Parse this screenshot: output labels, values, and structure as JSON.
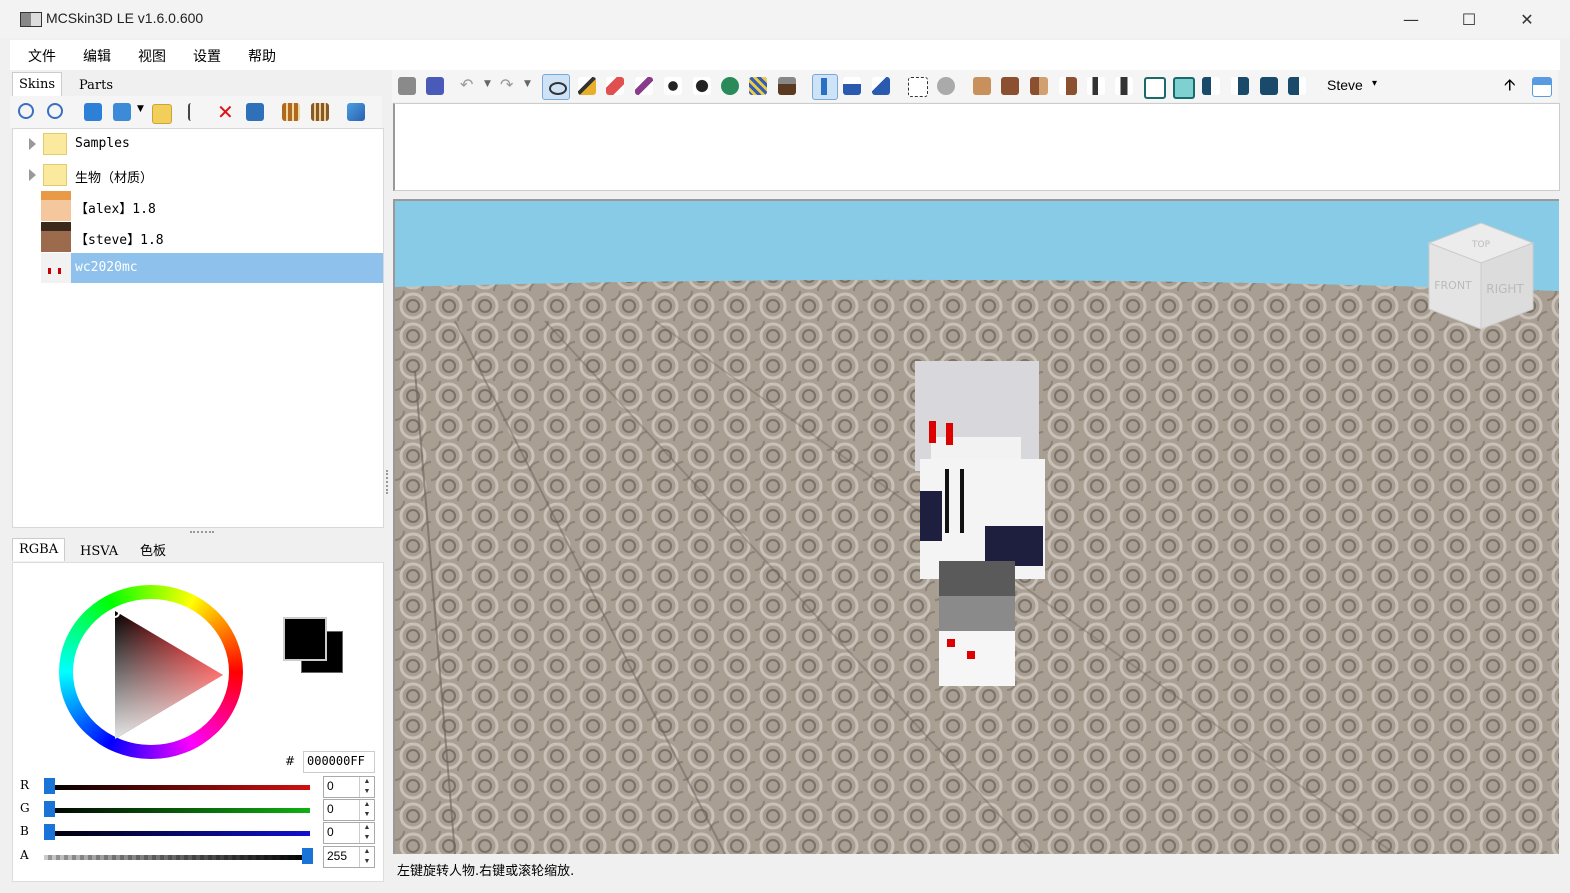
{
  "window": {
    "title": "MCSkin3D LE v1.6.0.600",
    "minimize_glyph": "—",
    "maximize_glyph": "☐",
    "close_glyph": "✕"
  },
  "menu": [
    "文件",
    "编辑",
    "视图",
    "设置",
    "帮助"
  ],
  "left_tabs": [
    "Skins",
    "Parts"
  ],
  "tree": {
    "items": [
      {
        "label": "Samples",
        "icon": "folder-icon"
      },
      {
        "label": "生物（材质）",
        "icon": "folder-icon"
      },
      {
        "label": "【alex】1.8",
        "icon": "alex-skin-avatar"
      },
      {
        "label": "【steve】1.8",
        "icon": "steve-skin-avatar"
      },
      {
        "label": "wc2020mc",
        "icon": "wc2020mc-skin-avatar"
      }
    ]
  },
  "color": {
    "tabs": [
      "RGBA",
      "HSVA",
      "色板"
    ],
    "hash": "#",
    "hex": "000000FF",
    "channels": [
      {
        "label": "R",
        "value": "0",
        "fraction": 0,
        "color": "#d01010"
      },
      {
        "label": "G",
        "value": "0",
        "fraction": 0,
        "color": "#10b010"
      },
      {
        "label": "B",
        "value": "0",
        "fraction": 0,
        "color": "#1010d0"
      },
      {
        "label": "A",
        "value": "255",
        "fraction": 1,
        "color": "#666666"
      }
    ]
  },
  "toolbar": {
    "model_select": "Steve",
    "model_arrow": "▾",
    "up_arrow": "🡩"
  },
  "viewcube": {
    "top": "TOP",
    "front": "FRONT",
    "right": "RIGHT"
  },
  "status": "左键旋转人物.右键或滚轮缩放."
}
